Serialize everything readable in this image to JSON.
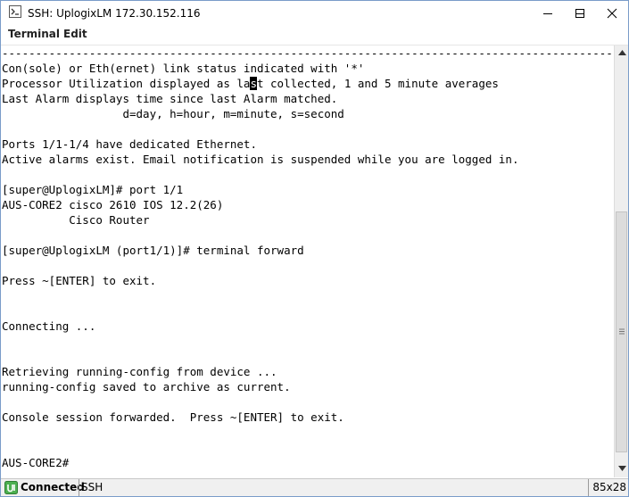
{
  "window": {
    "title": "SSH: UplogixLM 172.30.152.116"
  },
  "menu": {
    "items": [
      "Terminal",
      "Edit"
    ]
  },
  "terminal": {
    "cursor_line": 2,
    "cursor_col": 37,
    "lines": [
      "-------------------------------------------------------------------------------------------",
      "Con(sole) or Eth(ernet) link status indicated with '*'",
      "Processor Utilization displayed as last collected, 1 and 5 minute averages",
      "Last Alarm displays time since last Alarm matched.",
      "                  d=day, h=hour, m=minute, s=second",
      "",
      "Ports 1/1-1/4 have dedicated Ethernet.",
      "Active alarms exist. Email notification is suspended while you are logged in.",
      "",
      "[super@UplogixLM]# port 1/1",
      "AUS-CORE2 cisco 2610 IOS 12.2(26)",
      "          Cisco Router",
      "",
      "[super@UplogixLM (port1/1)]# terminal forward",
      "",
      "Press ~[ENTER] to exit.",
      "",
      "",
      "Connecting ...",
      "",
      "",
      "Retrieving running-config from device ...",
      "running-config saved to archive as current.",
      "",
      "Console session forwarded.  Press ~[ENTER] to exit.",
      "",
      "",
      "AUS-CORE2#"
    ]
  },
  "statusbar": {
    "connection": "Connected",
    "protocol": "SSH",
    "size": "85x28"
  },
  "colors": {
    "terminal_bg": "#ffffff",
    "terminal_fg": "#000000",
    "status_icon": "#4caf50"
  }
}
